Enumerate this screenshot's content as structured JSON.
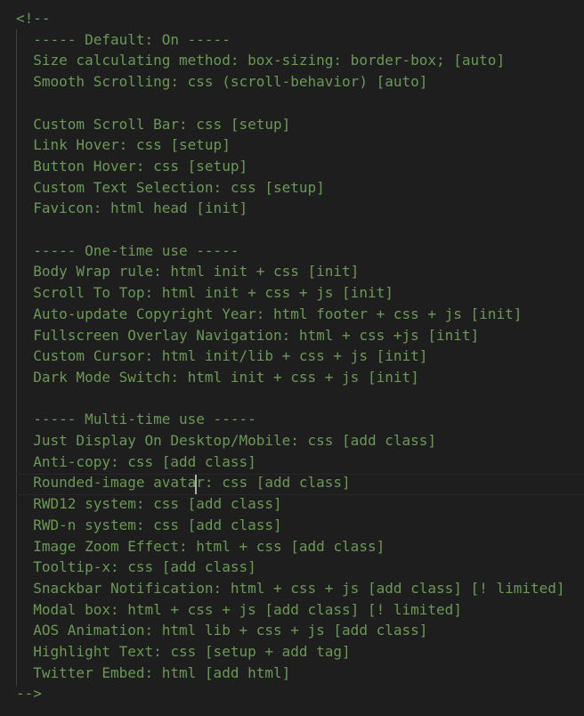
{
  "editor": {
    "lines": [
      "<!--",
      "  ----- Default: On -----",
      "  Size calculating method: box-sizing: border-box; [auto]",
      "  Smooth Scrolling: css (scroll-behavior) [auto]",
      "",
      "  Custom Scroll Bar: css [setup]",
      "  Link Hover: css [setup]",
      "  Button Hover: css [setup]",
      "  Custom Text Selection: css [setup]",
      "  Favicon: html head [init]",
      "",
      "  ----- One-time use -----",
      "  Body Wrap rule: html init + css [init]",
      "  Scroll To Top: html init + css + js [init]",
      "  Auto-update Copyright Year: html footer + css + js [init]",
      "  Fullscreen Overlay Navigation: html + css +js [init]",
      "  Custom Cursor: html init/lib + css + js [init]",
      "  Dark Mode Switch: html init + css + js [init]",
      "",
      "  ----- Multi-time use -----",
      "  Just Display On Desktop/Mobile: css [add class]",
      "  Anti-copy: css [add class]",
      "  Rounded-image avatar: css [add class]",
      "  RWD12 system: css [add class]",
      "  RWD-n system: css [add class]",
      "  Image Zoom Effect: html + css [add class]",
      "  Tooltip-x: css [add class]",
      "  Snackbar Notification: html + css + js [add class] [! limited]",
      "  Modal box: html + css + js [add class] [! limited]",
      "  AOS Animation: html lib + css + js [add class]",
      "  Highlight Text: css [setup + add tag]",
      "  Twitter Embed: html [add html]",
      "-->"
    ],
    "comment_color": "#6a9955",
    "background_color": "#1e1e1e"
  }
}
